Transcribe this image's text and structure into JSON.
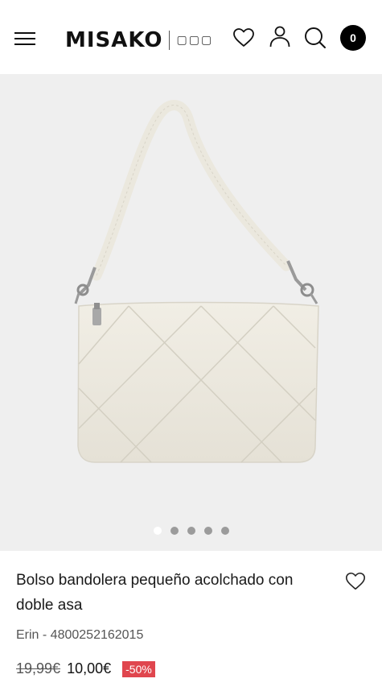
{
  "header": {
    "logo_text": "MISAKO",
    "logo_sub": "▢▢▢",
    "cart_count": "0",
    "icons": [
      "menu-icon",
      "heart-icon",
      "user-icon",
      "search-icon",
      "cart-icon"
    ]
  },
  "gallery": {
    "dots_total": 5,
    "active_dot": 1
  },
  "product": {
    "title": "Bolso bandolera pequeño acolchado con doble asa",
    "sku": "Erin - 4800252162015",
    "old_price": "19,99€",
    "new_price": "10,00€",
    "discount": "-50%"
  },
  "colors": {
    "accent": "#e0464e",
    "badge": "#000000",
    "bag": "#ece9df",
    "gallery_bg": "#efefef"
  }
}
